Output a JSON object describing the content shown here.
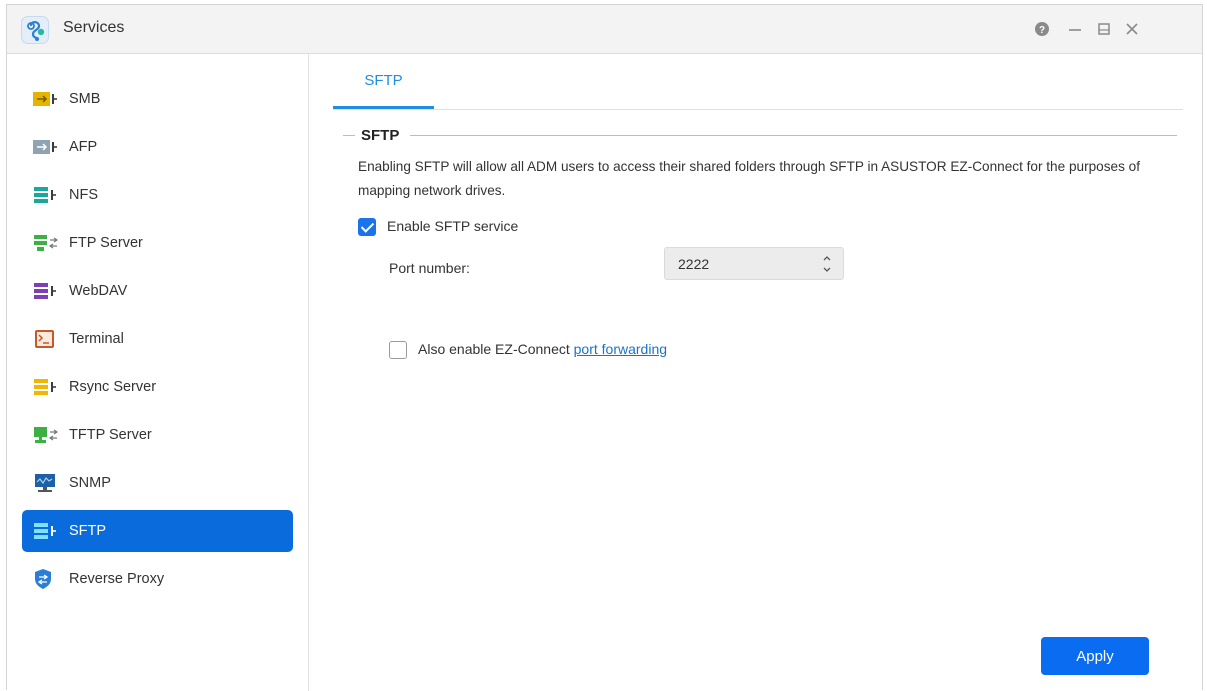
{
  "window": {
    "title": "Services"
  },
  "title_controls": {
    "help": "?",
    "minimize": "—",
    "maximize": "▭",
    "close": "✕"
  },
  "sidebar": {
    "items": [
      {
        "label": "SMB",
        "icon": "smb-icon",
        "color": "#e5b400"
      },
      {
        "label": "AFP",
        "icon": "afp-icon",
        "color": "#8fa3b3"
      },
      {
        "label": "NFS",
        "icon": "nfs-icon",
        "color": "#1aa89a"
      },
      {
        "label": "FTP Server",
        "icon": "ftp-server-icon",
        "color": "#3cb043"
      },
      {
        "label": "WebDAV",
        "icon": "webdav-icon",
        "color": "#7b3fb8"
      },
      {
        "label": "Terminal",
        "icon": "terminal-icon",
        "color": "#c45a2a"
      },
      {
        "label": "Rsync Server",
        "icon": "rsync-server-icon",
        "color": "#f2b600"
      },
      {
        "label": "TFTP Server",
        "icon": "tftp-server-icon",
        "color": "#3cb043"
      },
      {
        "label": "SNMP",
        "icon": "snmp-icon",
        "color": "#1f5fa8"
      },
      {
        "label": "SFTP",
        "icon": "sftp-icon",
        "color": "#ffffff",
        "active": true
      },
      {
        "label": "Reverse Proxy",
        "icon": "reverse-proxy-icon",
        "color": "#2a7fd4"
      }
    ]
  },
  "main": {
    "tab": {
      "label": "SFTP"
    },
    "section": {
      "title": "SFTP",
      "description": "Enabling SFTP will allow all ADM users to access their shared folders through SFTP in ASUSTOR EZ-Connect for the purposes of mapping network drives."
    },
    "enable_sftp": {
      "label": "Enable SFTP service",
      "checked": true
    },
    "port": {
      "label": "Port number:",
      "value": "2222"
    },
    "ez_connect": {
      "label": "Also enable EZ-Connect ",
      "link": "port forwarding",
      "checked": false
    },
    "apply_label": "Apply"
  },
  "colors": {
    "accent": "#0a6cdc",
    "tab": "#1f8ee0",
    "link": "#1a73c8"
  }
}
